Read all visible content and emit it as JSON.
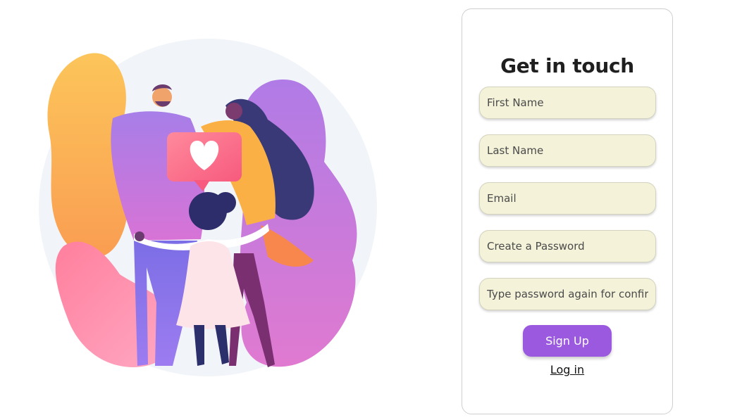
{
  "form": {
    "title": "Get in touch",
    "first_name_placeholder": "First Name",
    "last_name_placeholder": "Last Name",
    "email_placeholder": "Email",
    "password_placeholder": "Create a Password",
    "confirm_password_placeholder": "Type password again for confirmation",
    "signup_label": "Sign Up",
    "login_label": "Log in"
  },
  "colors": {
    "accent": "#9b59e0",
    "input_background": "#f4f3da"
  },
  "illustration": {
    "subject": "family-hug-with-heart-icon"
  }
}
